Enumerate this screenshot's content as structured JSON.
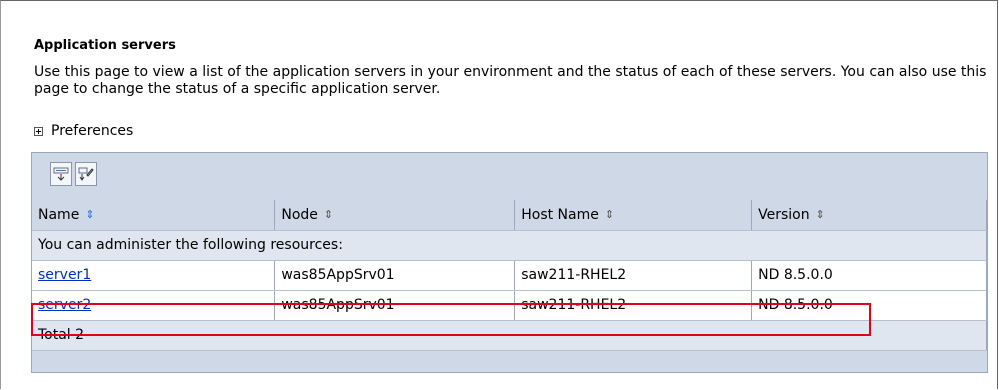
{
  "page": {
    "title": "Application servers",
    "description": "Use this page to view a list of the application servers in your environment and the status of each of these servers. You can also use this page to change the status of a specific application server.",
    "preferences_label": "Preferences"
  },
  "toolbar": {
    "buttons": [
      {
        "icon": "select-all-icon"
      },
      {
        "icon": "deselect-all-icon"
      }
    ]
  },
  "table": {
    "columns": [
      {
        "label": "Name",
        "sort_icon": "⇕"
      },
      {
        "label": "Node",
        "sort_icon": "⇕"
      },
      {
        "label": "Host Name",
        "sort_icon": "⇕"
      },
      {
        "label": "Version",
        "sort_icon": "⇕"
      }
    ],
    "group_label": "You can administer the following resources:",
    "rows": [
      {
        "name": "server1",
        "node": "was85AppSrv01",
        "host": "saw211-RHEL2",
        "version": "ND 8.5.0.0"
      },
      {
        "name": "server2",
        "node": "was85AppSrv01",
        "host": "saw211-RHEL2",
        "version": "ND 8.5.0.0"
      }
    ],
    "total": "Total 2"
  },
  "colors": {
    "panel_bg": "#cfd8e6",
    "link": "#0030c0",
    "highlight": "#e0001b"
  }
}
